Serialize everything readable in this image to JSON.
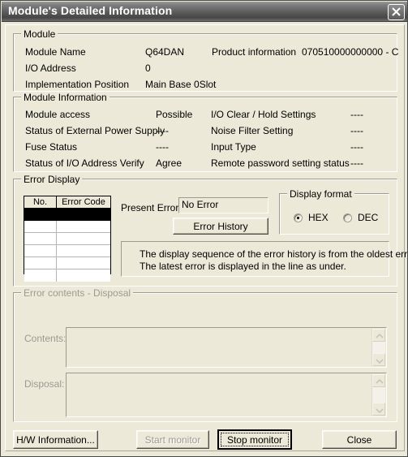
{
  "window": {
    "title": "Module's Detailed Information",
    "close_icon": "close-icon"
  },
  "module_group": {
    "title": "Module",
    "rows": [
      {
        "label": "Module Name",
        "value": "Q64DAN"
      },
      {
        "label": "I/O Address",
        "value": "0"
      },
      {
        "label": "Implementation Position",
        "value": "Main Base  0Slot"
      }
    ],
    "product_information_label": "Product information",
    "product_information_value": "070510000000000 - C"
  },
  "module_information_group": {
    "title": "Module Information",
    "left_rows": [
      {
        "label": "Module access",
        "value": "Possible"
      },
      {
        "label": "Status of External Power Supply",
        "value": "----"
      },
      {
        "label": "Fuse Status",
        "value": "----"
      },
      {
        "label": "Status of I/O Address Verify",
        "value": "Agree"
      }
    ],
    "right_rows": [
      {
        "label": "I/O Clear / Hold Settings",
        "value": "----"
      },
      {
        "label": "Noise Filter Setting",
        "value": "----"
      },
      {
        "label": "Input Type",
        "value": "----"
      },
      {
        "label": "Remote password setting status",
        "value": "----"
      }
    ]
  },
  "error_display_group": {
    "title": "Error Display",
    "table": {
      "columns": [
        "No.",
        "Error Code"
      ],
      "rows": [
        {
          "no": "",
          "code": "",
          "selected": true
        },
        {
          "no": "",
          "code": "",
          "selected": false
        },
        {
          "no": "",
          "code": "",
          "selected": false
        },
        {
          "no": "",
          "code": "",
          "selected": false
        },
        {
          "no": "",
          "code": "",
          "selected": false
        },
        {
          "no": "",
          "code": "",
          "selected": false
        }
      ]
    },
    "present_error_label": "Present Error",
    "present_error_value": "No Error",
    "error_history_button": "Error History",
    "display_format": {
      "title": "Display format",
      "options": [
        {
          "label": "HEX",
          "selected": true
        },
        {
          "label": "DEC",
          "selected": false
        }
      ]
    },
    "info_text": {
      "line1": "The display sequence of the error history is from the oldest error.",
      "line2": "The latest error is displayed in the line as under."
    }
  },
  "error_contents_group": {
    "title": "Error contents - Disposal",
    "contents_label": "Contents:",
    "contents_value": "",
    "disposal_label": "Disposal:",
    "disposal_value": "",
    "scroll_up_icon": "chevron-up-icon",
    "scroll_down_icon": "chevron-down-icon"
  },
  "footer": {
    "hw_information_button": "H/W Information...",
    "start_monitor_button": "Start monitor",
    "stop_monitor_button": "Stop monitor",
    "close_button": "Close"
  }
}
